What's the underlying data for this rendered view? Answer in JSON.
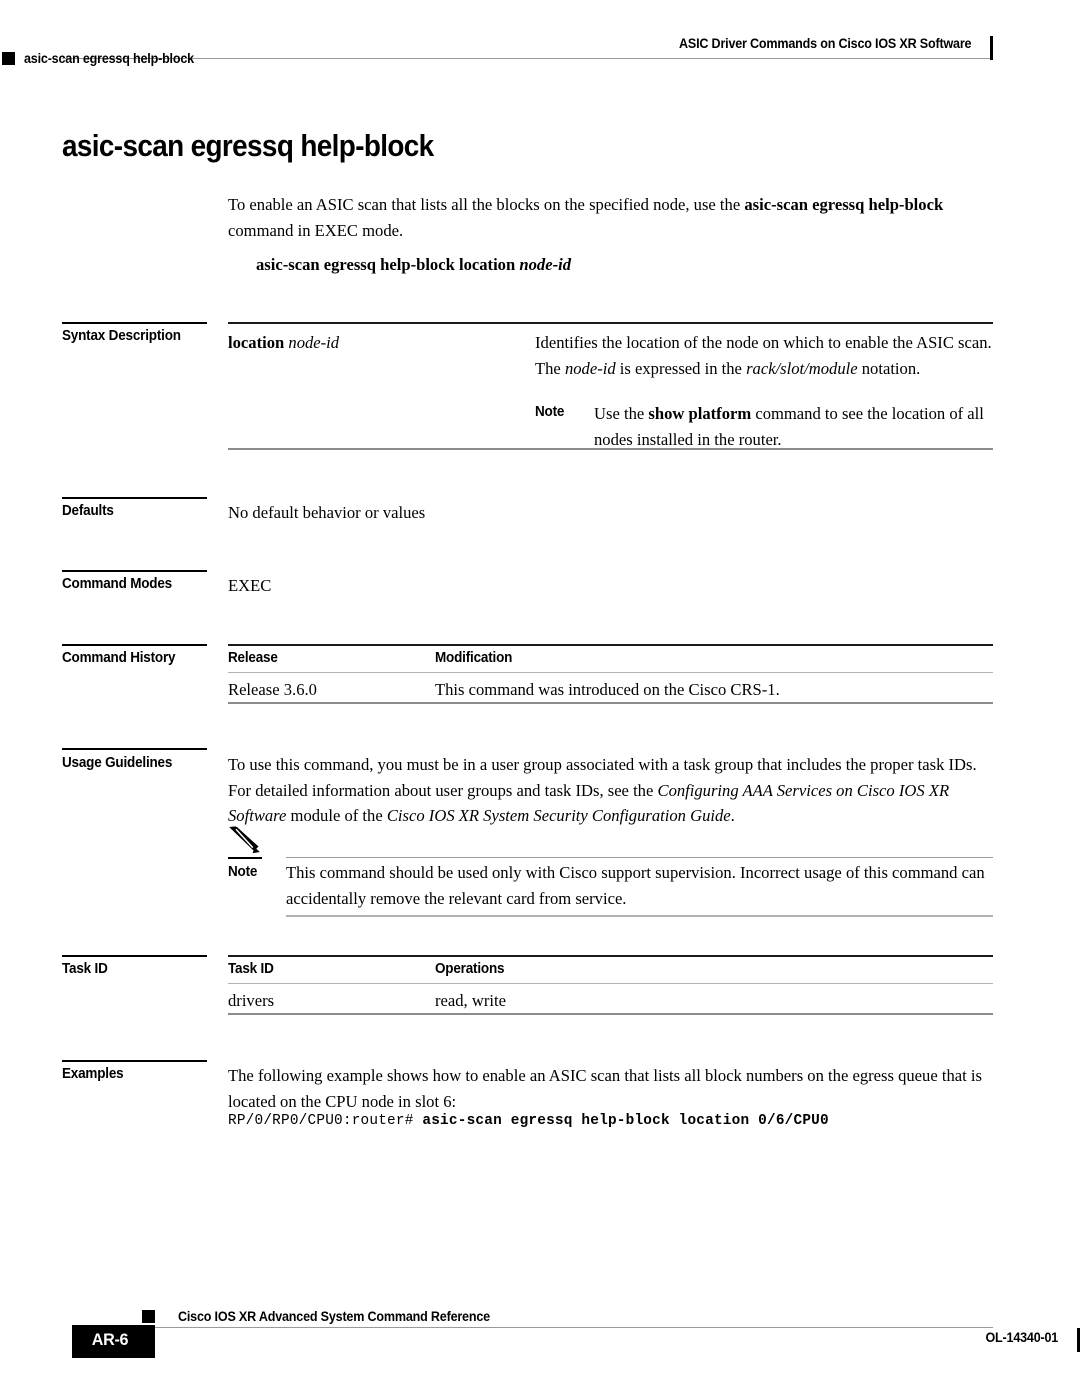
{
  "header": {
    "running_title": "ASIC Driver Commands on Cisco IOS XR Software",
    "running_left": "asic-scan egressq help-block"
  },
  "page_title": "asic-scan egressq help-block",
  "intro": {
    "text_before_bold": "To enable an ASIC scan that lists all the blocks on the specified node, use the ",
    "bold_command": "asic-scan egressq help-block",
    "text_after_bold": " command in EXEC mode."
  },
  "syntax_line": {
    "command": "asic-scan egressq help-block location",
    "argument": "node-id"
  },
  "sections": {
    "syntax_description": {
      "label": "Syntax Description",
      "term_bold": "location",
      "term_italic": "node-id",
      "desc_part1": "Identifies the location of the node on which to enable the ASIC scan. The ",
      "desc_italic1": "node-id",
      "desc_part2": " is expressed in the ",
      "desc_italic2": "rack/slot/module",
      "desc_part3": " notation.",
      "note_label": "Note",
      "note_part1": "Use the ",
      "note_bold": "show platform",
      "note_part2": " command to see the location of all nodes installed in the router."
    },
    "defaults": {
      "label": "Defaults",
      "value": "No default behavior or values"
    },
    "command_modes": {
      "label": "Command Modes",
      "value": "EXEC"
    },
    "command_history": {
      "label": "Command History",
      "columns": [
        "Release",
        "Modification"
      ],
      "rows": [
        {
          "release": "Release 3.6.0",
          "modification": "This command was introduced on the Cisco CRS-1."
        }
      ]
    },
    "usage_guidelines": {
      "label": "Usage Guidelines",
      "part1": "To use this command, you must be in a user group associated with a task group that includes the proper task IDs. For detailed information about user groups and task IDs, see the ",
      "italic1": "Configuring AAA Services on Cisco IOS XR Software",
      "part2": " module of the ",
      "italic2": "Cisco IOS XR System Security Configuration Guide",
      "part3": ".",
      "callout": {
        "icon": "pencil-icon",
        "label": "Note",
        "text": "This command should be used only with Cisco support supervision. Incorrect usage of this command can accidentally remove the relevant card from service."
      }
    },
    "task_id": {
      "label": "Task ID",
      "columns": [
        "Task ID",
        "Operations"
      ],
      "rows": [
        {
          "task_id": "drivers",
          "operations": "read, write"
        }
      ]
    },
    "examples": {
      "label": "Examples",
      "text": "The following example shows how to enable an ASIC scan that lists all block numbers on the egress queue that is located on the CPU node in slot 6:",
      "cli_prompt": "RP/0/RP0/CPU0:router# ",
      "cli_command": "asic-scan egressq help-block location 0/6/CPU0"
    }
  },
  "footer": {
    "guide_title": "Cisco IOS XR Advanced System Command Reference",
    "page_number": "AR-6",
    "doc_id": "OL-14340-01"
  },
  "colors": {
    "ink": "#000000",
    "rule_dark": "#1a1a1a",
    "rule_mid": "#8c8c8c",
    "rule_light": "#b2b2b2",
    "page_bg": "#ffffff"
  }
}
